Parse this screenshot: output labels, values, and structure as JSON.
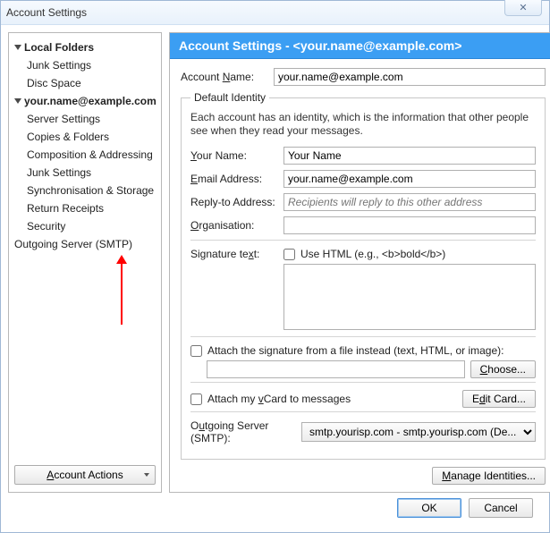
{
  "window": {
    "title": "Account Settings",
    "close": "✕"
  },
  "sidebar": {
    "root1": {
      "label": "Local Folders"
    },
    "root1_children": [
      {
        "label": "Junk Settings"
      },
      {
        "label": "Disc Space"
      }
    ],
    "root2": {
      "label": "your.name@example.com"
    },
    "root2_children": [
      {
        "label": "Server Settings"
      },
      {
        "label": "Copies & Folders"
      },
      {
        "label": "Composition & Addressing"
      },
      {
        "label": "Junk Settings"
      },
      {
        "label": "Synchronisation & Storage"
      },
      {
        "label": "Return Receipts"
      },
      {
        "label": "Security"
      }
    ],
    "outgoing": "Outgoing Server (SMTP)",
    "account_actions": "Account Actions"
  },
  "header": {
    "prefix": "Account Settings - ",
    "email": "<your.name@example.com>"
  },
  "form": {
    "account_name_label": "Account Name:",
    "account_name_value": "your.name@example.com",
    "default_identity": "Default Identity",
    "identity_desc": "Each account has an identity, which is the information that other people see when they read your messages.",
    "your_name_label": "Your Name:",
    "your_name_value": "Your Name",
    "email_label": "Email Address:",
    "email_value": "your.name@example.com",
    "replyto_label": "Reply-to Address:",
    "replyto_placeholder": "Recipients will reply to this other address",
    "org_label": "Organisation:",
    "org_value": "",
    "sig_label": "Signature text:",
    "use_html_label": "Use HTML (e.g., <b>bold</b>)",
    "sig_value": "",
    "attach_sig_file": "Attach the signature from a file instead (text, HTML, or image):",
    "sig_file_value": "",
    "choose_btn": "Choose...",
    "attach_vcard": "Attach my vCard to messages",
    "edit_card": "Edit Card...",
    "outgoing_label": "Outgoing Server (SMTP):",
    "outgoing_value": "smtp.yourisp.com - smtp.yourisp.com (De...",
    "manage_identities": "Manage Identities..."
  },
  "footer": {
    "ok": "OK",
    "cancel": "Cancel"
  }
}
